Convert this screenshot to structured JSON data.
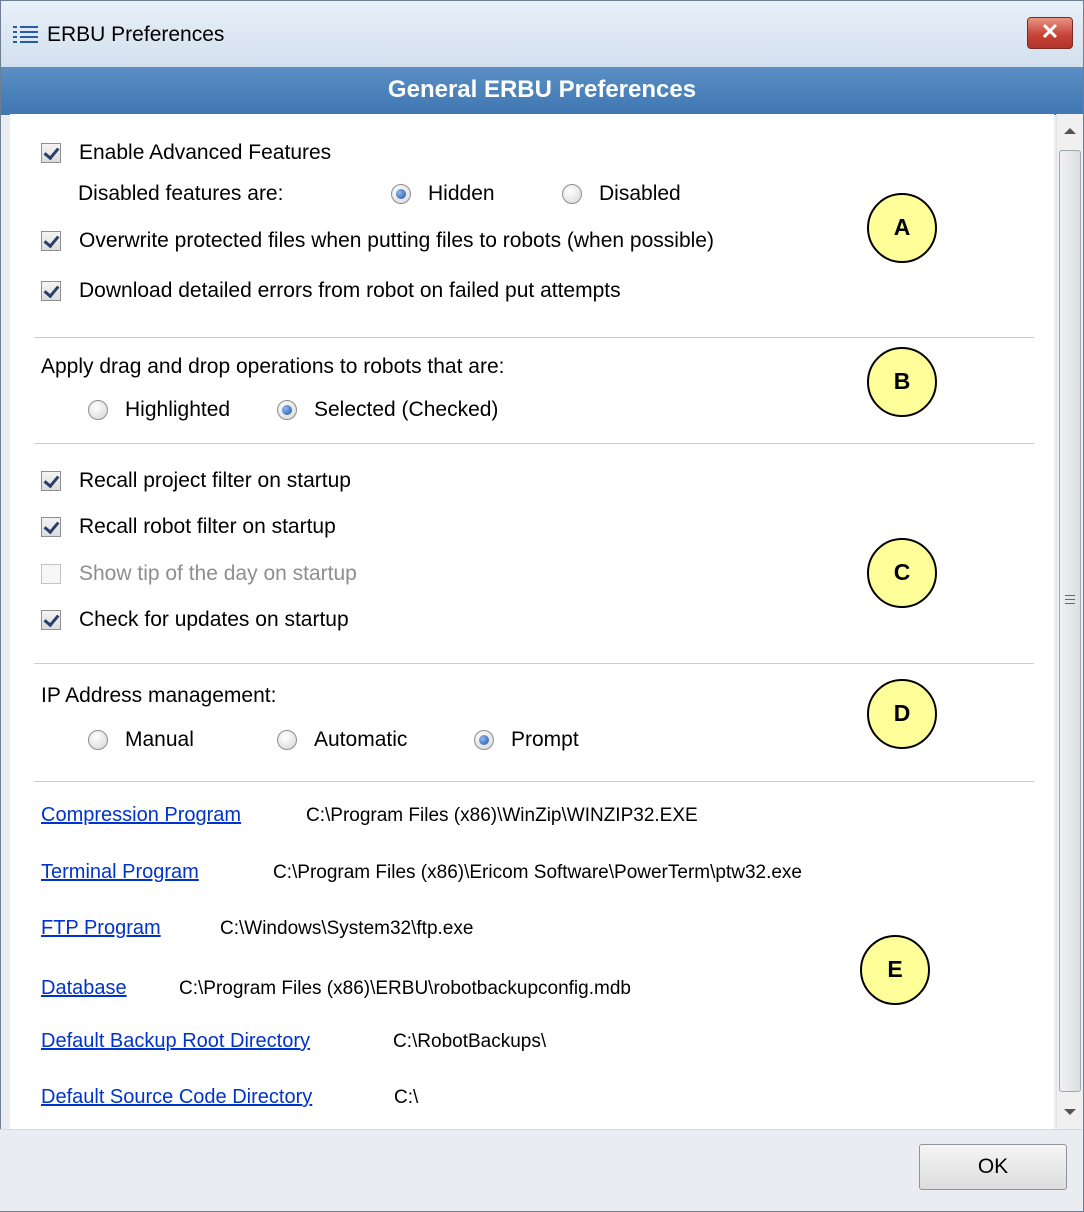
{
  "window": {
    "title": "ERBU Preferences",
    "close_glyph": "✕",
    "header": "General ERBU Preferences",
    "icon": "list-icon"
  },
  "section_a": {
    "enable_advanced": {
      "label": "Enable Advanced Features",
      "checked": true
    },
    "disabled_features_label": "Disabled features are:",
    "disabled_features_options": [
      {
        "label": "Hidden",
        "selected": true
      },
      {
        "label": "Disabled",
        "selected": false
      }
    ],
    "overwrite_protected": {
      "label": "Overwrite protected files when putting files to robots (when possible)",
      "checked": true
    },
    "download_errors": {
      "label": "Download detailed errors from robot on failed put attempts",
      "checked": true
    },
    "badge": "A"
  },
  "section_b": {
    "label": "Apply drag and drop operations to robots that are:",
    "options": [
      {
        "label": "Highlighted",
        "selected": false
      },
      {
        "label": "Selected (Checked)",
        "selected": true
      }
    ],
    "badge": "B"
  },
  "section_c": {
    "items": [
      {
        "label": "Recall project filter on startup",
        "checked": true,
        "enabled": true
      },
      {
        "label": "Recall robot filter on startup",
        "checked": true,
        "enabled": true
      },
      {
        "label": "Show tip of the day on startup",
        "checked": false,
        "enabled": false
      },
      {
        "label": "Check for updates on startup",
        "checked": true,
        "enabled": true
      }
    ],
    "badge": "C"
  },
  "section_d": {
    "label": "IP Address management:",
    "options": [
      {
        "label": "Manual",
        "selected": false
      },
      {
        "label": "Automatic",
        "selected": false
      },
      {
        "label": "Prompt",
        "selected": true
      }
    ],
    "badge": "D"
  },
  "section_e": {
    "programs": [
      {
        "link": "Compression Program",
        "path": "C:\\Program Files (x86)\\WinZip\\WINZIP32.EXE"
      },
      {
        "link": "Terminal Program",
        "path": "C:\\Program Files (x86)\\Ericom Software\\PowerTerm\\ptw32.exe"
      },
      {
        "link": "FTP Program",
        "path": "C:\\Windows\\System32\\ftp.exe"
      },
      {
        "link": "Database",
        "path": "C:\\Program Files (x86)\\ERBU\\robotbackupconfig.mdb"
      },
      {
        "link": "Default Backup Root Directory",
        "path": "C:\\RobotBackups\\"
      },
      {
        "link": "Default Source Code Directory",
        "path": "C:\\"
      }
    ],
    "badge": "E"
  },
  "footer": {
    "ok_label": "OK"
  }
}
